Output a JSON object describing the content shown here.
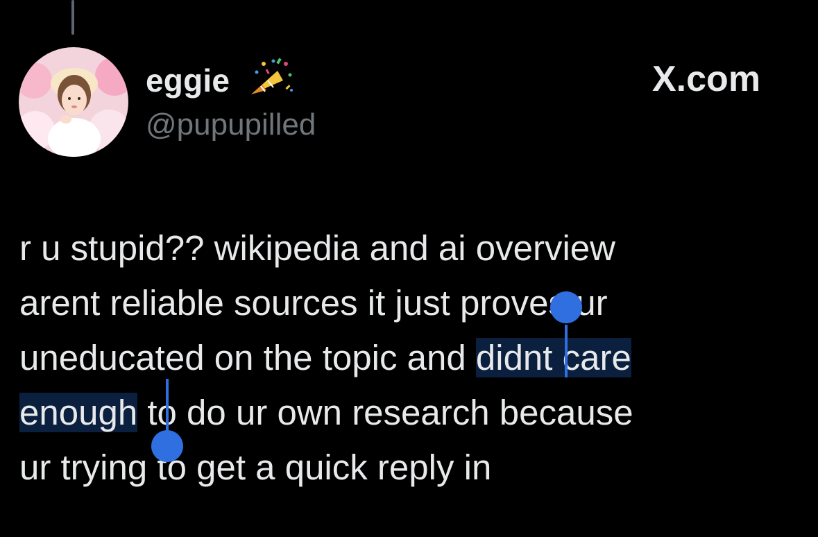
{
  "author": {
    "display_name": "eggie",
    "handle": "@pupupilled",
    "badge_icon": "party-popper-icon"
  },
  "brand": "X.com",
  "tweet": {
    "line1": "r u stupid?? wikipedia and ai overview",
    "line2": "arent reliable sources it just proves ur",
    "line3_pre": "uneducated on the topic and ",
    "line3_sel": "didnt care",
    "line4_sel": "enough",
    "line4_post": " to do ur own research because",
    "line5": "ur trying to get a quick reply in"
  },
  "colors": {
    "background": "#000000",
    "text": "#e7e9ea",
    "secondary_text": "#71767b",
    "selection_highlight": "#0b1f3f",
    "selection_handle": "#2f6fe0"
  }
}
